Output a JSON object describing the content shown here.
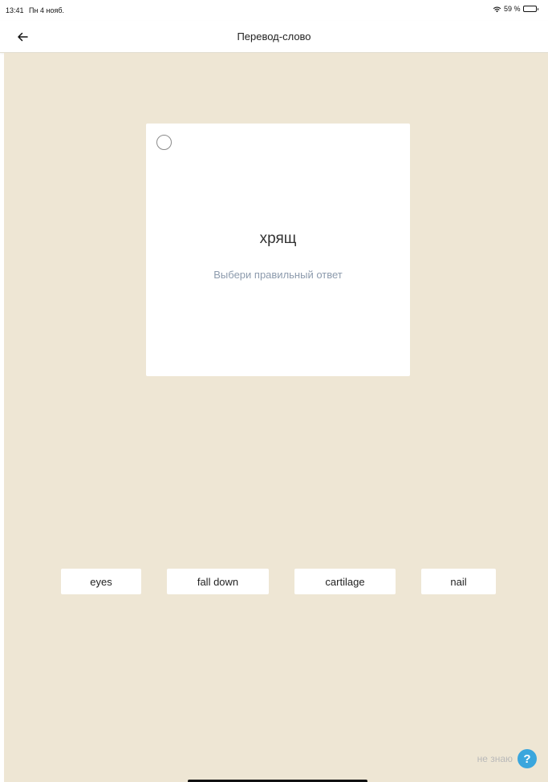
{
  "status_bar": {
    "time": "13:41",
    "date": "Пн 4 нояб.",
    "battery": "59 %",
    "icons": [
      "wifi-icon",
      "battery-icon"
    ]
  },
  "nav": {
    "title": "Перевод-слово",
    "back_icon": "arrow-left-icon"
  },
  "card": {
    "word": "хрящ",
    "hint": "Выбери правильный ответ"
  },
  "options": [
    {
      "label": "eyes"
    },
    {
      "label": "fall down"
    },
    {
      "label": "cartilage"
    },
    {
      "label": "nail"
    }
  ],
  "dont_know": {
    "label": "не знаю",
    "icon": "?"
  },
  "colors": {
    "background": "#eee6d4",
    "accent": "#3aa6dd",
    "hint": "#8d9bad"
  }
}
